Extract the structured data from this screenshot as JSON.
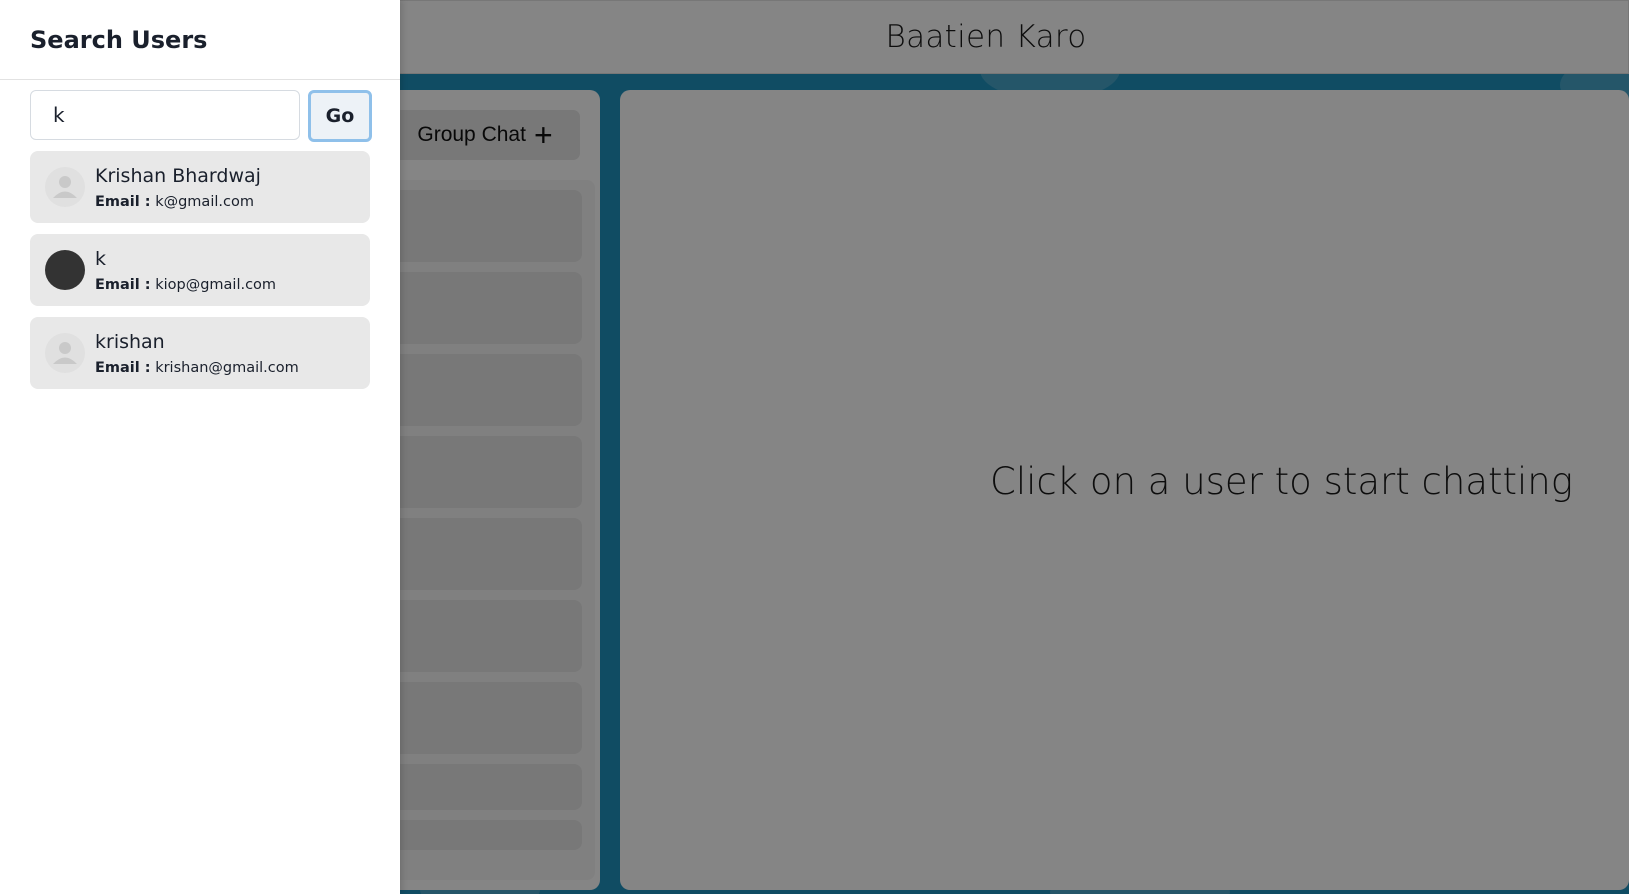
{
  "app": {
    "title": "Baatien Karo",
    "new_group_label": "Group Chat",
    "new_group_icon": "plus-icon",
    "empty_message": "Click on a user to start chatting"
  },
  "drawer": {
    "title": "Search Users",
    "search": {
      "value": "k",
      "placeholder": ""
    },
    "go_label": "Go",
    "email_label": "Email :",
    "results": [
      {
        "name": "Krishan Bhardwaj",
        "email": "k@gmail.com",
        "avatar": "default-user-icon"
      },
      {
        "name": "k",
        "email": "kiop@gmail.com",
        "avatar": "dark-avatar"
      },
      {
        "name": "krishan",
        "email": "krishan@gmail.com",
        "avatar": "default-user-icon"
      }
    ]
  },
  "colors": {
    "backdrop": "#1f93bf",
    "overlay": "rgba(0,0,0,0.48)",
    "focus_ring": "#8fc0ea"
  }
}
